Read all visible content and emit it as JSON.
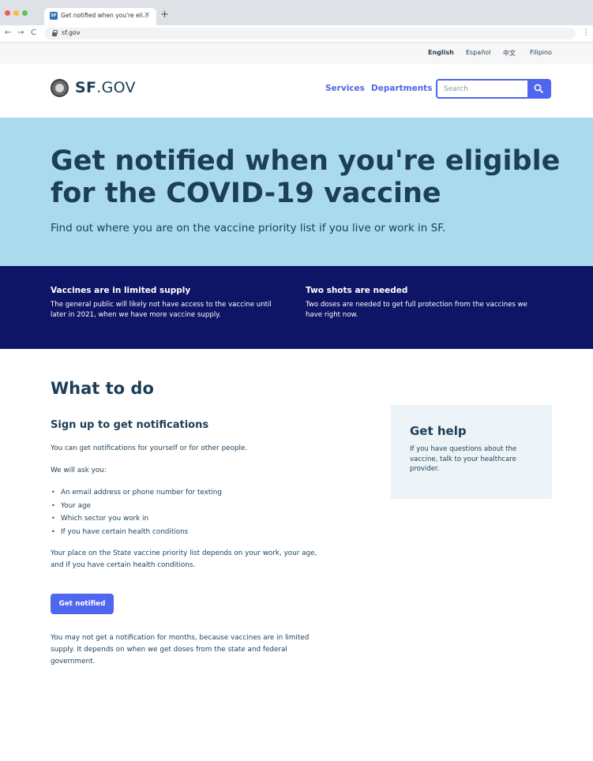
{
  "browser": {
    "tab_title": "Get notified when you're eli...",
    "tab_favicon_text": "SF",
    "tab_close": "×",
    "new_tab": "+",
    "url": "sf.gov",
    "back": "←",
    "forward": "→",
    "reload": "C",
    "menu": "⋮"
  },
  "languages": [
    "English",
    "Español",
    "中文",
    "Filipino"
  ],
  "header": {
    "logo_bold": "SF",
    "logo_rest": ".GOV",
    "nav": [
      "Services",
      "Departments"
    ],
    "search_placeholder": "Search"
  },
  "hero": {
    "title": "Get notified when you're eligible for the COVID-19 vaccine",
    "subtitle": "Find out where you are on the vaccine priority list if you live or work in SF."
  },
  "notices": [
    {
      "title": "Vaccines are in limited supply",
      "body": "The general public will likely not have access to the vaccine until later in 2021, when we have more vaccine supply."
    },
    {
      "title": "Two shots are needed",
      "body": "Two doses are needed to get full protection from the vaccines we have right now."
    }
  ],
  "main": {
    "title": "What to do",
    "section_title": "Sign up to get notifications",
    "intro": "You can get notifications for yourself or for other people.",
    "ask_intro": "We will ask you:",
    "bullets": [
      "An email address or phone number for texting",
      "Your age",
      "Which sector you work in",
      "If you have certain health conditions"
    ],
    "priority_text": "Your place on the State vaccine priority list depends on your work, your age, and if you have certain health conditions.",
    "cta_label": "Get notified",
    "footnote": "You may not get a notification for months, because vaccines are in limited supply. It depends on when we get doses from the state and federal government."
  },
  "help": {
    "title": "Get help",
    "body": "If you have questions about the vaccine, talk to your healthcare provider."
  },
  "colors": {
    "accent": "#4f66ee",
    "hero_bg": "#a9daee",
    "notice_bg": "#0f1566",
    "text": "#1c3e57",
    "help_bg": "#edf4f7"
  }
}
